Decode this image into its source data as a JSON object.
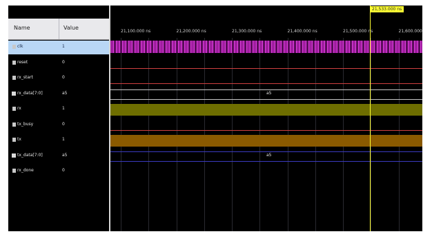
{
  "columns": {
    "name": "Name",
    "value": "Value"
  },
  "signals": [
    {
      "name": "clk",
      "value": "1",
      "kind": "clock",
      "color": "#a01ea0"
    },
    {
      "name": "reset",
      "value": "0",
      "kind": "low",
      "color": "#d04040"
    },
    {
      "name": "rx_start",
      "value": "0",
      "kind": "low",
      "color": "#d04040"
    },
    {
      "name": "rx_data[7:0]",
      "value": "a5",
      "kind": "bus",
      "bus_value": "a5",
      "color": "#c8c8c8"
    },
    {
      "name": "rx",
      "value": "1",
      "kind": "high",
      "color": "#6e6e00"
    },
    {
      "name": "tx_busy",
      "value": "0",
      "kind": "low",
      "color": "#d04040"
    },
    {
      "name": "tx",
      "value": "1",
      "kind": "high",
      "color": "#8a5a00"
    },
    {
      "name": "tx_data[7:0]",
      "value": "a5",
      "kind": "bus",
      "bus_value": "a5",
      "color": "#3a3ac0"
    },
    {
      "name": "rx_done",
      "value": "0",
      "kind": "none",
      "color": "#000000"
    }
  ],
  "ruler": {
    "labels": [
      "21,100.000 ns",
      "21,200.000 ns",
      "21,300.000 ns",
      "21,400.000 ns",
      "21,500.000 ns",
      "21,600.000 ns"
    ]
  },
  "cursor": {
    "label": "21,533.000 ns"
  }
}
